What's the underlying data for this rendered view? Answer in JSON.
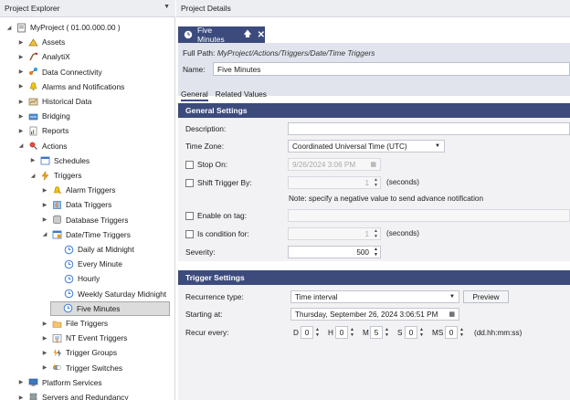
{
  "explorer": {
    "title": "Project Explorer",
    "items": [
      {
        "label": "MyProject ( 01.00.000.00 )",
        "icon": "project-icon",
        "level": 0,
        "expander": "▲"
      },
      {
        "label": "Assets",
        "icon": "assets-icon",
        "level": 1,
        "expander": "▶"
      },
      {
        "label": "AnalytiX",
        "icon": "analytix-icon",
        "level": 1,
        "expander": "▶"
      },
      {
        "label": "Data Connectivity",
        "icon": "data-connectivity-icon",
        "level": 1,
        "expander": "▶"
      },
      {
        "label": "Alarms and Notifications",
        "icon": "alarms-icon",
        "level": 1,
        "expander": "▶"
      },
      {
        "label": "Historical Data",
        "icon": "historical-data-icon",
        "level": 1,
        "expander": "▶"
      },
      {
        "label": "Bridging",
        "icon": "bridging-icon",
        "level": 1,
        "expander": "▶"
      },
      {
        "label": "Reports",
        "icon": "reports-icon",
        "level": 1,
        "expander": "▶"
      },
      {
        "label": "Actions",
        "icon": "actions-icon",
        "level": 1,
        "expander": "▲"
      },
      {
        "label": "Schedules",
        "icon": "schedules-icon",
        "level": 2,
        "expander": "▶"
      },
      {
        "label": "Triggers",
        "icon": "triggers-icon",
        "level": 2,
        "expander": "▲"
      },
      {
        "label": "Alarm Triggers",
        "icon": "alarm-triggers-icon",
        "level": 3,
        "expander": "▶"
      },
      {
        "label": "Data Triggers",
        "icon": "data-triggers-icon",
        "level": 3,
        "expander": "▶"
      },
      {
        "label": "Database Triggers",
        "icon": "database-triggers-icon",
        "level": 3,
        "expander": "▶"
      },
      {
        "label": "Date/Time Triggers",
        "icon": "datetime-triggers-icon",
        "level": 3,
        "expander": "▲"
      },
      {
        "label": "Daily at Midnight",
        "icon": "clock-icon",
        "level": 4,
        "expander": ""
      },
      {
        "label": "Every Minute",
        "icon": "clock-icon",
        "level": 4,
        "expander": ""
      },
      {
        "label": "Hourly",
        "icon": "clock-icon",
        "level": 4,
        "expander": ""
      },
      {
        "label": "Weekly Saturday Midnight",
        "icon": "clock-icon",
        "level": 4,
        "expander": ""
      },
      {
        "label": "Five Minutes",
        "icon": "clock-icon",
        "level": 4,
        "expander": "",
        "selected": true
      },
      {
        "label": "File Triggers",
        "icon": "file-triggers-icon",
        "level": 3,
        "expander": "▶"
      },
      {
        "label": "NT Event Triggers",
        "icon": "nt-event-triggers-icon",
        "level": 3,
        "expander": "▶"
      },
      {
        "label": "Trigger Groups",
        "icon": "trigger-groups-icon",
        "level": 3,
        "expander": "▶"
      },
      {
        "label": "Trigger Switches",
        "icon": "trigger-switches-icon",
        "level": 3,
        "expander": "▶"
      },
      {
        "label": "Platform Services",
        "icon": "platform-services-icon",
        "level": 1,
        "expander": "▶"
      },
      {
        "label": "Servers and Redundancy",
        "icon": "servers-icon",
        "level": 1,
        "expander": "▶"
      }
    ]
  },
  "details": {
    "title": "Project Details",
    "tab_label": "Five Minutes",
    "fullpath_label": "Full Path:",
    "fullpath_value": "MyProject/Actions/Triggers/Date/Time Triggers",
    "name_label": "Name:",
    "name_value": "Five Minutes",
    "subtabs": [
      "General",
      "Related Values"
    ]
  },
  "general": {
    "header": "General Settings",
    "description_label": "Description:",
    "description_value": "",
    "timezone_label": "Time Zone:",
    "timezone_value": "Coordinated Universal Time (UTC)",
    "stopon_label": "Stop On:",
    "stopon_value": "9/26/2024 3:06 PM",
    "shift_label": "Shift Trigger By:",
    "shift_value": "1",
    "seconds_unit": "(seconds)",
    "note": "Note: specify a negative value to send advance notification",
    "enable_tag_label": "Enable on tag:",
    "is_condition_label": "Is condition for:",
    "is_condition_value": "1",
    "severity_label": "Severity:",
    "severity_value": "500"
  },
  "trigger": {
    "header": "Trigger Settings",
    "recurrence_label": "Recurrence type:",
    "recurrence_value": "Time interval",
    "preview_label": "Preview",
    "starting_label": "Starting at:",
    "starting_value": "Thursday, September 26, 2024 3:06:51 PM",
    "recur_label": "Recur every:",
    "recur_parts": [
      {
        "unit": "D",
        "value": "0"
      },
      {
        "unit": "H",
        "value": "0"
      },
      {
        "unit": "M",
        "value": "5"
      },
      {
        "unit": "S",
        "value": "0"
      },
      {
        "unit": "MS",
        "value": "0"
      }
    ],
    "recur_format": "(dd.hh:mm:ss)"
  },
  "colors": {
    "accent": "#3c4b7c",
    "band": "#e1e4ed"
  }
}
